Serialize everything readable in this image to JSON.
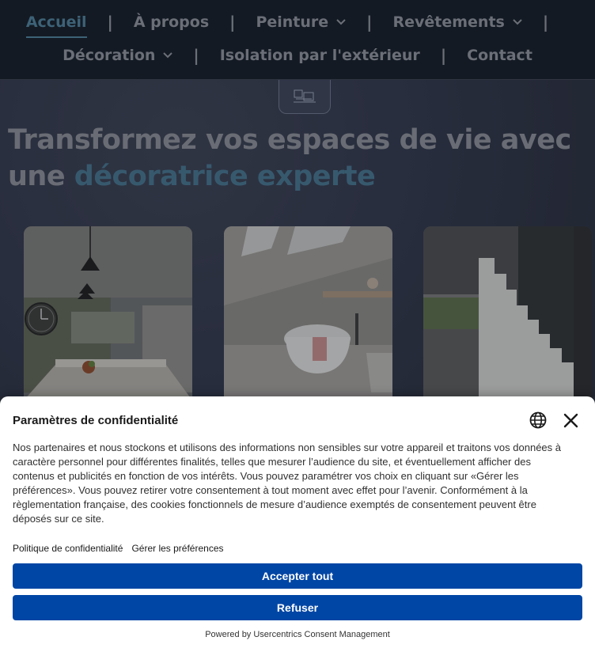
{
  "nav": {
    "row1": [
      {
        "label": "Accueil",
        "active": true,
        "dropdown": false
      },
      {
        "label": "À propos",
        "active": false,
        "dropdown": false
      },
      {
        "label": "Peinture",
        "active": false,
        "dropdown": true
      },
      {
        "label": "Revêtements",
        "active": false,
        "dropdown": true
      }
    ],
    "row2": [
      {
        "label": "Décoration",
        "active": false,
        "dropdown": true
      },
      {
        "label": "Isolation par l'extérieur",
        "active": false,
        "dropdown": false
      },
      {
        "label": "Contact",
        "active": false,
        "dropdown": false
      }
    ],
    "separator": "|"
  },
  "hero": {
    "headline_part1": "Transformez vos espaces de vie avec une ",
    "headline_accent": "décoratrice experte"
  },
  "cards": [
    {
      "name": "kitchen-photo"
    },
    {
      "name": "bathroom-photo"
    },
    {
      "name": "staircase-photo"
    }
  ],
  "consent": {
    "title": "Paramètres de confidentialité",
    "body": "Nos partenaires et nous stockons et utilisons des informations non sensibles sur votre appareil et traitons vos données à caractère personnel pour différentes finalités, telles que mesurer l’audience du site, et éventuellement afficher des contenus et publicités en fonction de vos intérêts. Vous pouvez paramétrer vos choix en cliquant sur «Gérer les préférences». Vous pouvez retirer votre consentement à tout moment avec effet pour l’avenir. Conformément à la règlementation française, des cookies fonctionnels de mesure d’audience exemptés de consentement peuvent être déposés sur ce site.",
    "privacy_link": "Politique de confidentialité",
    "manage_link": "Gérer les préférences",
    "accept_label": "Accepter tout",
    "refuse_label": "Refuser",
    "powered_by": "Powered by Usercentrics Consent Management"
  },
  "colors": {
    "nav_bg": "#141b25",
    "accent": "#4d7e99",
    "button_blue": "#0046a5"
  }
}
